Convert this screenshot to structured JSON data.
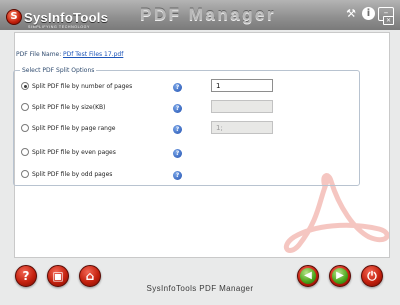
{
  "window": {
    "brand": "SysInfoTools",
    "brand_badge": "S",
    "brand_tagline": "SIMPLIFYING TECHNOLOGY",
    "title": "PDF Manager",
    "icons": [
      "tools-icon",
      "info-icon",
      "minimize-icon",
      "maximize-icon"
    ]
  },
  "file": {
    "label": "PDF File Name:",
    "value": "PDf Test Files 17.pdf"
  },
  "options": {
    "legend": "Select PDF Split Options",
    "items": [
      {
        "label": "Split PDF file by number of pages",
        "checked": true,
        "field_value": "1",
        "field_enabled": true
      },
      {
        "label": "Split PDF file by size(KB)",
        "checked": false,
        "field_value": "",
        "field_enabled": false
      },
      {
        "label": "Split PDF file by page range",
        "checked": false,
        "field_value": "1;",
        "field_enabled": false
      },
      {
        "label": "Split PDF file by even pages",
        "checked": false
      },
      {
        "label": "Split PDF file by odd pages",
        "checked": false
      }
    ]
  },
  "footer": {
    "text": "SysInfoTools PDF Manager",
    "left_buttons": [
      "help-icon",
      "register-icon",
      "purchase-icon"
    ],
    "right_buttons": [
      "back-icon",
      "next-icon",
      "exit-icon"
    ]
  },
  "colors": {
    "brand_red": "#c5220f",
    "nav_green": "#4aa51a",
    "link_blue": "#1d55b8"
  }
}
